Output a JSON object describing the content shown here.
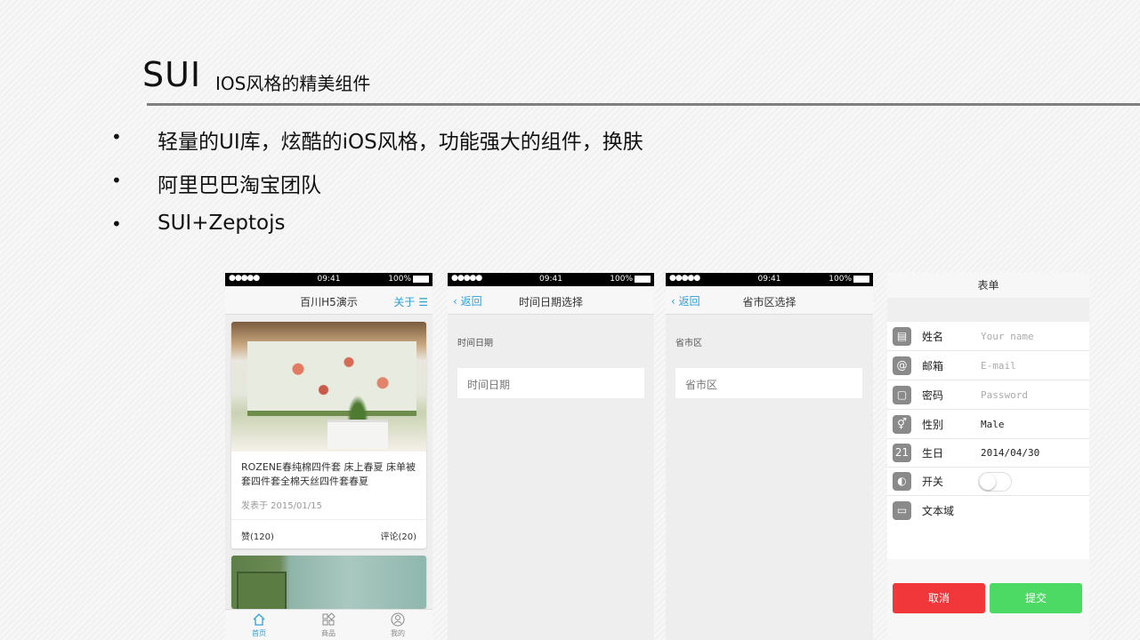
{
  "slide": {
    "title": "SUI",
    "subtitle": "IOS风格的精美组件",
    "bullets": [
      "轻量的UI库，炫酷的iOS风格，功能强大的组件，换肤",
      "阿里巴巴淘宝团队",
      "SUI+Zeptojs"
    ]
  },
  "status_bar": {
    "signal": "●●●●● ",
    "time": "09:41",
    "battery": "100%"
  },
  "screen1": {
    "title": "百川H5演示",
    "about": "关于",
    "card": {
      "title": "ROZENE春纯棉四件套 床上春夏 床单被套四件套全棉天丝四件套春夏",
      "date": "发表于 2015/01/15",
      "likes": "赞(120)",
      "comments": "评论(20)"
    },
    "tabs": [
      "首页",
      "商品",
      "我的"
    ]
  },
  "screen2": {
    "back": "返回",
    "title": "时间日期选择",
    "section": "时间日期",
    "input": "时间日期"
  },
  "screen3": {
    "back": "返回",
    "title": "省市区选择",
    "section": "省市区",
    "input": "省市区"
  },
  "form": {
    "title": "表单",
    "rows": [
      {
        "label": "姓名",
        "placeholder": "Your name",
        "icon": "name-card-icon"
      },
      {
        "label": "邮箱",
        "placeholder": "E-mail",
        "icon": "at-icon"
      },
      {
        "label": "密码",
        "placeholder": "Password",
        "icon": "lock-icon"
      },
      {
        "label": "性别",
        "value": "Male",
        "icon": "gender-icon"
      },
      {
        "label": "生日",
        "value": "2014/04/30",
        "icon": "calendar-icon",
        "icon_text": "21"
      },
      {
        "label": "开关",
        "icon": "switch-icon"
      },
      {
        "label": "文本域",
        "icon": "chat-icon"
      }
    ],
    "cancel": "取消",
    "submit": "提交"
  },
  "colors": {
    "accent": "#2e9fd8",
    "cancel": "#f2373b",
    "submit": "#4cd964"
  }
}
